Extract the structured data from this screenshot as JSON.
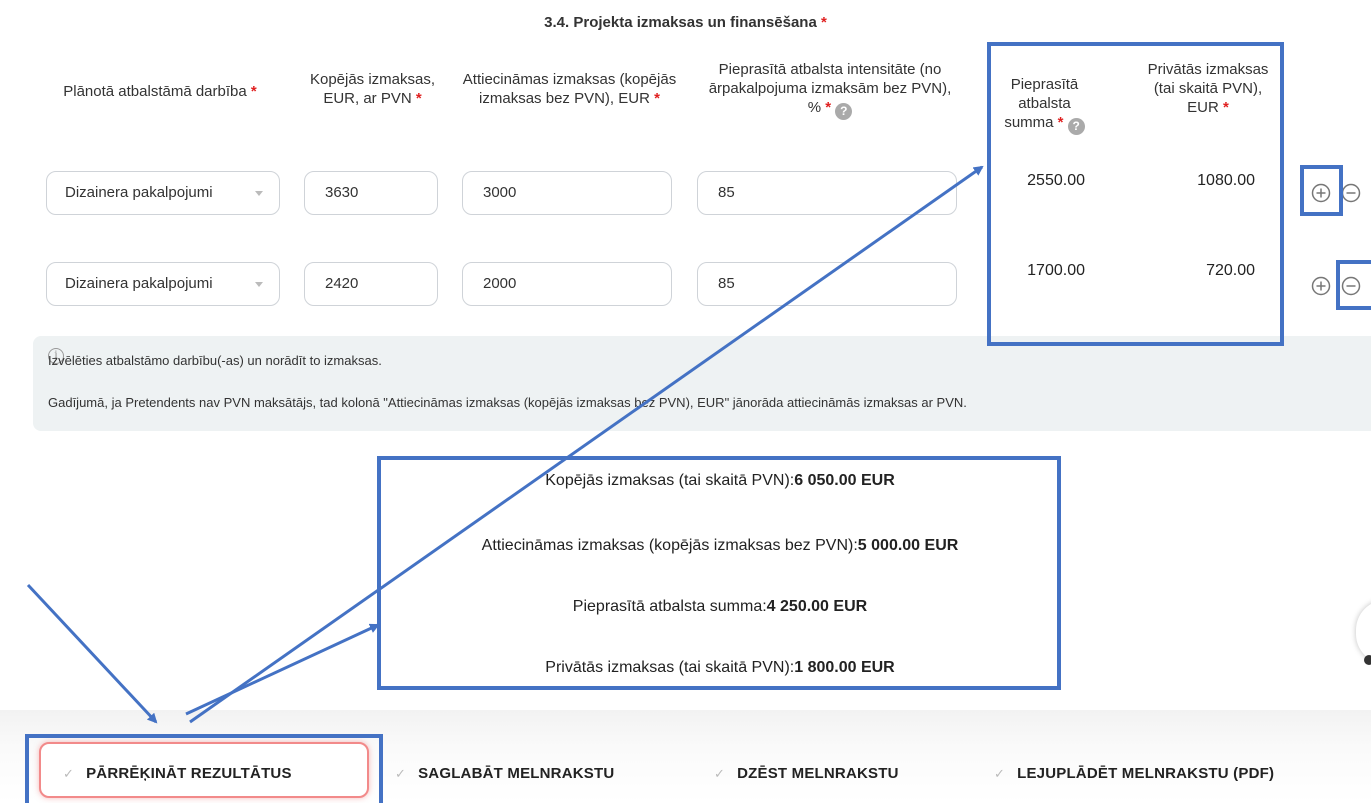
{
  "section": {
    "title": "3.4. Projekta izmaksas un finansēšana",
    "required_mark": "*"
  },
  "columns": {
    "activity": "Plānotā atbalstāmā darbība",
    "total_costs": "Kopējās izmaksas, EUR, ar PVN",
    "eligible_costs": "Attiecināmas izmaksas (kopējās izmaksas bez PVN), EUR",
    "intensity": "Pieprasītā atbalsta intensitāte (no ārpakalpojuma izmaksām bez PVN), %",
    "support_amount": "Pieprasītā atbalsta summa",
    "private_costs": "Privātās izmaksas (tai skaitā PVN), EUR",
    "help_glyph": "?"
  },
  "rows": [
    {
      "activity": "Dizainera pakalpojumi",
      "total": "3630",
      "eligible": "3000",
      "intensity": "85",
      "support": "2550.00",
      "private": "1080.00"
    },
    {
      "activity": "Dizainera pakalpojumi",
      "total": "2420",
      "eligible": "2000",
      "intensity": "85",
      "support": "1700.00",
      "private": "720.00"
    }
  ],
  "info": {
    "icon": "info-icon",
    "line1": "Izvēlēties atbalstāmo darbību(-as) un norādīt to izmaksas.",
    "line2": "Gadījumā, ja Pretendents nav PVN maksātājs, tad kolonā \"Attiecināmas izmaksas (kopējās izmaksas bez PVN), EUR\" jānorāda attiecināmās izmaksas ar PVN."
  },
  "summary": {
    "total_label": "Kopējās izmaksas (tai skaitā PVN):",
    "total_value": "6 050.00 EUR",
    "eligible_label": "Attiecināmas izmaksas (kopējās izmaksas bez PVN):",
    "eligible_value": "5 000.00 EUR",
    "support_label": "Pieprasītā atbalsta summa:",
    "support_value": "4 250.00 EUR",
    "private_label": "Privātās izmaksas (tai skaitā PVN):",
    "private_value": "1 800.00 EUR"
  },
  "actions": {
    "recalc": "PĀRRĒĶINĀT REZULTĀTUS",
    "save": "SAGLABĀT MELNRAKSTU",
    "delete": "DZĒST MELNRAKSTU",
    "download": "LEJUPLĀDĒT MELNRAKSTU (PDF)",
    "check_glyph": "✓"
  },
  "colors": {
    "annotation": "#4472c4",
    "required": "#e02020",
    "primary_border": "#f28a8a",
    "info_bg": "#eef2f3"
  }
}
